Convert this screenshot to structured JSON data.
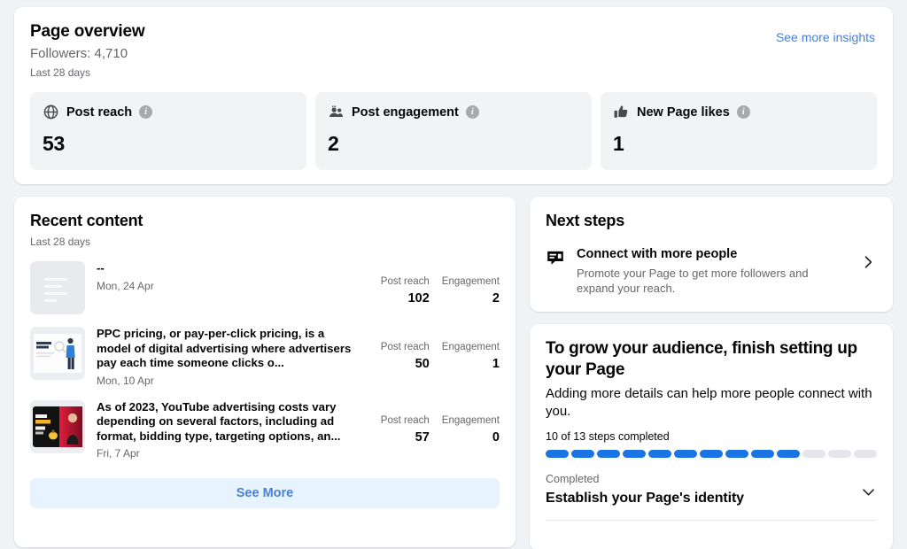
{
  "overview": {
    "title": "Page overview",
    "followers": "Followers: 4,710",
    "period": "Last 28 days",
    "see_more_insights": "See more insights",
    "metrics": [
      {
        "icon": "globe-icon",
        "label": "Post reach",
        "value": "53",
        "info": "i"
      },
      {
        "icon": "people-icon",
        "label": "Post engagement",
        "value": "2",
        "info": "i"
      },
      {
        "icon": "thumbs-up-icon",
        "label": "New Page likes",
        "value": "1",
        "info": "i"
      }
    ]
  },
  "recent_content": {
    "title": "Recent content",
    "period": "Last 28 days",
    "stat_labels": {
      "reach": "Post reach",
      "engagement": "Engagement"
    },
    "posts": [
      {
        "text": "--",
        "date": "Mon, 24 Apr",
        "reach_label": "Post reach",
        "reach": "102",
        "engagement_label": "Engagement",
        "engagement": "2",
        "thumb": "placeholder-lines"
      },
      {
        "text": "PPC pricing, or pay-per-click pricing, is a model of digital advertising where advertisers pay each time someone clicks o...",
        "date": "Mon, 10 Apr",
        "reach_label": "Post reach",
        "reach": "50",
        "engagement_label": "Engagement",
        "engagement": "1",
        "thumb": "ppc-article-thumbnail"
      },
      {
        "text": "As of 2023, YouTube advertising costs vary depending on several factors, including ad format, bidding type, targeting options, an...",
        "date": "Fri, 7 Apr",
        "reach_label": "Post reach",
        "reach": "57",
        "engagement_label": "Engagement",
        "engagement": "0",
        "thumb": "youtube-cost-thumbnail"
      }
    ],
    "see_more": "See More"
  },
  "next_steps": {
    "title": "Next steps",
    "items": [
      {
        "icon": "ad-bubble-icon",
        "title": "Connect with more people",
        "description": "Promote your Page to get more followers and expand your reach."
      }
    ]
  },
  "grow_audience": {
    "title": "To grow your audience, finish setting up your Page",
    "description": "Adding more details can help more people connect with you.",
    "steps_text": "10 of 13 steps completed",
    "steps_total": 13,
    "steps_completed": 10,
    "completed_label": "Completed",
    "completed_title": "Establish your Page's identity"
  },
  "colors": {
    "accent_blue": "#1b74e4",
    "link_blue": "#4a7fd4",
    "button_bg": "#e7f3ff",
    "page_bg": "#f0f2f5",
    "card_bg": "#ffffff",
    "metric_bg": "#f2f3f5",
    "muted_text": "#65676b",
    "progress_empty": "#e4e6eb"
  }
}
